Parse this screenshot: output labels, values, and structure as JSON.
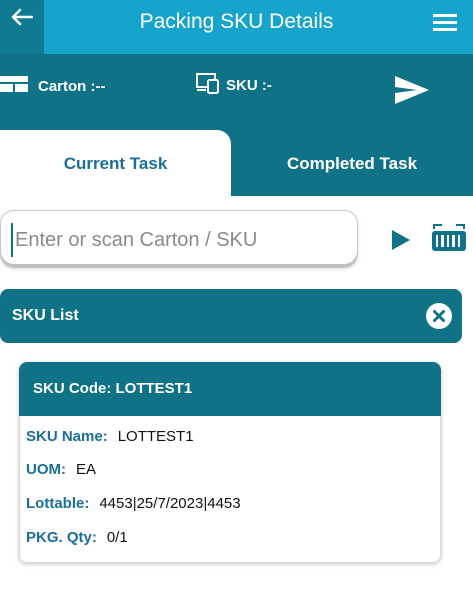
{
  "header": {
    "title": "Packing SKU Details",
    "back_icon": "arrow-left-icon",
    "menu_icon": "hamburger-icon"
  },
  "info": {
    "carton_label": "Carton :--",
    "sku_label": "SKU :-",
    "send_icon": "send-icon"
  },
  "tabs": [
    {
      "label": "Current Task",
      "active": true
    },
    {
      "label": "Completed Task",
      "active": false
    }
  ],
  "search": {
    "placeholder": "Enter or scan Carton / SKU",
    "value": ""
  },
  "sku_list": {
    "title": "SKU List"
  },
  "card": {
    "code_label": "SKU Code:",
    "code_value": "LOTTEST1",
    "rows": [
      {
        "label": "SKU Name:",
        "value": "LOTTEST1"
      },
      {
        "label": "UOM:",
        "value": "EA"
      },
      {
        "label": "Lottable:",
        "value": "4453|25/7/2023|4453"
      },
      {
        "label": "PKG. Qty:",
        "value": "0/1"
      }
    ]
  },
  "colors": {
    "header_bg": "#16a3cc",
    "primary_dark": "#0f7287",
    "label_blue": "#1b6f99"
  }
}
